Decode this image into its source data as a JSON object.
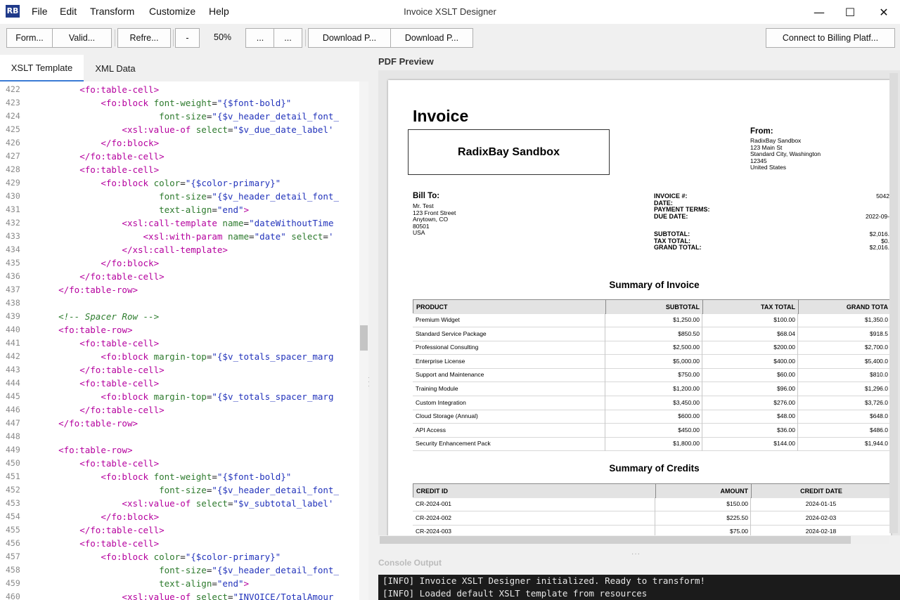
{
  "window": {
    "logo_text": "RB",
    "title": "Invoice XSLT Designer",
    "minimize_glyph": "—",
    "maximize_glyph": "☐",
    "close_glyph": "✕"
  },
  "menu": [
    "File",
    "Edit",
    "Transform",
    "Customize",
    "Help"
  ],
  "toolbar": {
    "format": "Form...",
    "validate": "Valid...",
    "refresh": "Refre...",
    "zoom_out": "-",
    "zoom_level": "50%",
    "more1": "...",
    "more2": "...",
    "download1": "Download P...",
    "download2": "Download P...",
    "connect": "Connect to Billing Platf..."
  },
  "tabs": {
    "xslt": "XSLT Template",
    "xml": "XML Data"
  },
  "editor": {
    "lines": [
      {
        "n": "422",
        "tokens": [
          [
            "p",
            "        "
          ],
          [
            "t",
            "<fo:table-cell>"
          ]
        ]
      },
      {
        "n": "423",
        "tokens": [
          [
            "p",
            "            "
          ],
          [
            "t",
            "<fo:block "
          ],
          [
            "a",
            "font-weight"
          ],
          [
            "p",
            "="
          ],
          [
            "v",
            "\"{$font-bold}\""
          ]
        ]
      },
      {
        "n": "424",
        "tokens": [
          [
            "p",
            "                       "
          ],
          [
            "a",
            "font-size"
          ],
          [
            "p",
            "="
          ],
          [
            "v",
            "\"{$v_header_detail_font_"
          ]
        ]
      },
      {
        "n": "425",
        "tokens": [
          [
            "p",
            "                "
          ],
          [
            "t",
            "<xsl:value-of "
          ],
          [
            "a",
            "select"
          ],
          [
            "p",
            "="
          ],
          [
            "v",
            "\"$v_due_date_label'"
          ]
        ]
      },
      {
        "n": "426",
        "tokens": [
          [
            "p",
            "            "
          ],
          [
            "t",
            "</fo:block>"
          ]
        ]
      },
      {
        "n": "427",
        "tokens": [
          [
            "p",
            "        "
          ],
          [
            "t",
            "</fo:table-cell>"
          ]
        ]
      },
      {
        "n": "428",
        "tokens": [
          [
            "p",
            "        "
          ],
          [
            "t",
            "<fo:table-cell>"
          ]
        ]
      },
      {
        "n": "429",
        "tokens": [
          [
            "p",
            "            "
          ],
          [
            "t",
            "<fo:block "
          ],
          [
            "a",
            "color"
          ],
          [
            "p",
            "="
          ],
          [
            "v",
            "\"{$color-primary}\""
          ]
        ]
      },
      {
        "n": "430",
        "tokens": [
          [
            "p",
            "                       "
          ],
          [
            "a",
            "font-size"
          ],
          [
            "p",
            "="
          ],
          [
            "v",
            "\"{$v_header_detail_font_"
          ]
        ]
      },
      {
        "n": "431",
        "tokens": [
          [
            "p",
            "                       "
          ],
          [
            "a",
            "text-align"
          ],
          [
            "p",
            "="
          ],
          [
            "v",
            "\"end\""
          ],
          [
            "t",
            ">"
          ]
        ]
      },
      {
        "n": "432",
        "tokens": [
          [
            "p",
            "                "
          ],
          [
            "t",
            "<xsl:call-template "
          ],
          [
            "a",
            "name"
          ],
          [
            "p",
            "="
          ],
          [
            "v",
            "\"dateWithoutTime"
          ]
        ]
      },
      {
        "n": "433",
        "tokens": [
          [
            "p",
            "                    "
          ],
          [
            "t",
            "<xsl:with-param "
          ],
          [
            "a",
            "name"
          ],
          [
            "p",
            "="
          ],
          [
            "v",
            "\"date\" "
          ],
          [
            "a",
            "select"
          ],
          [
            "p",
            "="
          ],
          [
            "v",
            "'"
          ]
        ]
      },
      {
        "n": "434",
        "tokens": [
          [
            "p",
            "                "
          ],
          [
            "t",
            "</xsl:call-template>"
          ]
        ]
      },
      {
        "n": "435",
        "tokens": [
          [
            "p",
            "            "
          ],
          [
            "t",
            "</fo:block>"
          ]
        ]
      },
      {
        "n": "436",
        "tokens": [
          [
            "p",
            "        "
          ],
          [
            "t",
            "</fo:table-cell>"
          ]
        ]
      },
      {
        "n": "437",
        "tokens": [
          [
            "p",
            "    "
          ],
          [
            "t",
            "</fo:table-row>"
          ]
        ]
      },
      {
        "n": "438",
        "tokens": []
      },
      {
        "n": "439",
        "tokens": [
          [
            "p",
            "    "
          ],
          [
            "c",
            "<!-- Spacer Row -->"
          ]
        ]
      },
      {
        "n": "440",
        "tokens": [
          [
            "p",
            "    "
          ],
          [
            "t",
            "<fo:table-row>"
          ]
        ]
      },
      {
        "n": "441",
        "tokens": [
          [
            "p",
            "        "
          ],
          [
            "t",
            "<fo:table-cell>"
          ]
        ]
      },
      {
        "n": "442",
        "tokens": [
          [
            "p",
            "            "
          ],
          [
            "t",
            "<fo:block "
          ],
          [
            "a",
            "margin-top"
          ],
          [
            "p",
            "="
          ],
          [
            "v",
            "\"{$v_totals_spacer_marg"
          ]
        ]
      },
      {
        "n": "443",
        "tokens": [
          [
            "p",
            "        "
          ],
          [
            "t",
            "</fo:table-cell>"
          ]
        ]
      },
      {
        "n": "444",
        "tokens": [
          [
            "p",
            "        "
          ],
          [
            "t",
            "<fo:table-cell>"
          ]
        ]
      },
      {
        "n": "445",
        "tokens": [
          [
            "p",
            "            "
          ],
          [
            "t",
            "<fo:block "
          ],
          [
            "a",
            "margin-top"
          ],
          [
            "p",
            "="
          ],
          [
            "v",
            "\"{$v_totals_spacer_marg"
          ]
        ]
      },
      {
        "n": "446",
        "tokens": [
          [
            "p",
            "        "
          ],
          [
            "t",
            "</fo:table-cell>"
          ]
        ]
      },
      {
        "n": "447",
        "tokens": [
          [
            "p",
            "    "
          ],
          [
            "t",
            "</fo:table-row>"
          ]
        ]
      },
      {
        "n": "448",
        "tokens": []
      },
      {
        "n": "449",
        "tokens": [
          [
            "p",
            "    "
          ],
          [
            "t",
            "<fo:table-row>"
          ]
        ]
      },
      {
        "n": "450",
        "tokens": [
          [
            "p",
            "        "
          ],
          [
            "t",
            "<fo:table-cell>"
          ]
        ]
      },
      {
        "n": "451",
        "tokens": [
          [
            "p",
            "            "
          ],
          [
            "t",
            "<fo:block "
          ],
          [
            "a",
            "font-weight"
          ],
          [
            "p",
            "="
          ],
          [
            "v",
            "\"{$font-bold}\""
          ]
        ]
      },
      {
        "n": "452",
        "tokens": [
          [
            "p",
            "                       "
          ],
          [
            "a",
            "font-size"
          ],
          [
            "p",
            "="
          ],
          [
            "v",
            "\"{$v_header_detail_font_"
          ]
        ]
      },
      {
        "n": "453",
        "tokens": [
          [
            "p",
            "                "
          ],
          [
            "t",
            "<xsl:value-of "
          ],
          [
            "a",
            "select"
          ],
          [
            "p",
            "="
          ],
          [
            "v",
            "\"$v_subtotal_label'"
          ]
        ]
      },
      {
        "n": "454",
        "tokens": [
          [
            "p",
            "            "
          ],
          [
            "t",
            "</fo:block>"
          ]
        ]
      },
      {
        "n": "455",
        "tokens": [
          [
            "p",
            "        "
          ],
          [
            "t",
            "</fo:table-cell>"
          ]
        ]
      },
      {
        "n": "456",
        "tokens": [
          [
            "p",
            "        "
          ],
          [
            "t",
            "<fo:table-cell>"
          ]
        ]
      },
      {
        "n": "457",
        "tokens": [
          [
            "p",
            "            "
          ],
          [
            "t",
            "<fo:block "
          ],
          [
            "a",
            "color"
          ],
          [
            "p",
            "="
          ],
          [
            "v",
            "\"{$color-primary}\""
          ]
        ]
      },
      {
        "n": "458",
        "tokens": [
          [
            "p",
            "                       "
          ],
          [
            "a",
            "font-size"
          ],
          [
            "p",
            "="
          ],
          [
            "v",
            "\"{$v_header_detail_font_"
          ]
        ]
      },
      {
        "n": "459",
        "tokens": [
          [
            "p",
            "                       "
          ],
          [
            "a",
            "text-align"
          ],
          [
            "p",
            "="
          ],
          [
            "v",
            "\"end\""
          ],
          [
            "t",
            ">"
          ]
        ]
      },
      {
        "n": "460",
        "tokens": [
          [
            "p",
            "                "
          ],
          [
            "t",
            "<xsl:value-of "
          ],
          [
            "a",
            "select"
          ],
          [
            "p",
            "="
          ],
          [
            "v",
            "\"INVOICE/TotalAmour"
          ]
        ]
      }
    ]
  },
  "pdf_preview": {
    "label": "PDF Preview",
    "invoice_title": "Invoice",
    "company_logo_text": "RadixBay Sandbox",
    "from": {
      "label": "From:",
      "lines": [
        "RadixBay Sandbox",
        "123 Main St",
        "Standard City, Washington",
        "12345",
        "United States"
      ]
    },
    "bill_to": {
      "label": "Bill To:",
      "lines": [
        "Mr. Test",
        "123 Front Street",
        "Anytown, CO",
        "80501",
        "USA"
      ]
    },
    "details": [
      {
        "label": "INVOICE #:",
        "value": "5042"
      },
      {
        "label": "DATE:",
        "value": ""
      },
      {
        "label": "PAYMENT TERMS:",
        "value": ""
      },
      {
        "label": "DUE DATE:",
        "value": "2022-09-"
      }
    ],
    "totals": [
      {
        "label": "SUBTOTAL:",
        "value": "$2,016."
      },
      {
        "label": "TAX TOTAL:",
        "value": "$0."
      },
      {
        "label": "GRAND TOTAL:",
        "value": "$2,016."
      }
    ],
    "summary_title": "Summary of Invoice",
    "summary_headers": [
      "PRODUCT",
      "SUBTOTAL",
      "TAX TOTAL",
      "GRAND TOTA"
    ],
    "summary_rows": [
      [
        "Premium Widget",
        "$1,250.00",
        "$100.00",
        "$1,350.0"
      ],
      [
        "Standard Service Package",
        "$850.50",
        "$68.04",
        "$918.5"
      ],
      [
        "Professional Consulting",
        "$2,500.00",
        "$200.00",
        "$2,700.0"
      ],
      [
        "Enterprise License",
        "$5,000.00",
        "$400.00",
        "$5,400.0"
      ],
      [
        "Support and Maintenance",
        "$750.00",
        "$60.00",
        "$810.0"
      ],
      [
        "Training Module",
        "$1,200.00",
        "$96.00",
        "$1,296.0"
      ],
      [
        "Custom Integration",
        "$3,450.00",
        "$276.00",
        "$3,726.0"
      ],
      [
        "Cloud Storage (Annual)",
        "$600.00",
        "$48.00",
        "$648.0"
      ],
      [
        "API Access",
        "$450.00",
        "$36.00",
        "$486.0"
      ],
      [
        "Security Enhancement Pack",
        "$1,800.00",
        "$144.00",
        "$1,944.0"
      ]
    ],
    "credits_title": "Summary of Credits",
    "credits_headers": [
      "CREDIT ID",
      "AMOUNT",
      "CREDIT DATE"
    ],
    "credits_rows": [
      [
        "CR-2024-001",
        "$150.00",
        "2024-01-15"
      ],
      [
        "CR-2024-002",
        "$225.50",
        "2024-02-03"
      ],
      [
        "CR-2024-003",
        "$75.00",
        "2024-02-18"
      ]
    ]
  },
  "console": {
    "label": "Console Output",
    "lines": [
      "[INFO] Invoice XSLT Designer initialized. Ready to transform!",
      "[INFO] Loaded default XSLT template from resources"
    ]
  }
}
